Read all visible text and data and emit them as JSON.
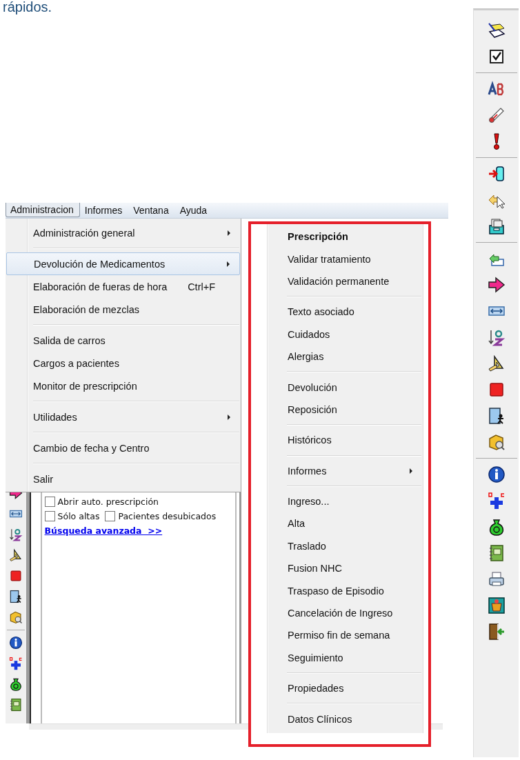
{
  "caption": "rápidos.",
  "menubar": [
    {
      "label": "Administracion",
      "selected": true
    },
    {
      "label": "Informes",
      "selected": false
    },
    {
      "label": "Ventana",
      "selected": false
    },
    {
      "label": "Ayuda",
      "selected": false
    }
  ],
  "admin_menu": {
    "groups": [
      [
        {
          "label": "Administración general",
          "submenu": true,
          "selected": false
        }
      ],
      [
        {
          "label": "Devolución de Medicamentos",
          "submenu": true,
          "selected": true
        },
        {
          "label": "Elaboración de fueras de hora",
          "shortcut": "Ctrl+F",
          "submenu": false,
          "selected": false
        },
        {
          "label": "Elaboración de mezclas",
          "submenu": false,
          "selected": false
        }
      ],
      [
        {
          "label": "Salida de carros",
          "submenu": false,
          "selected": false
        },
        {
          "label": "Cargos a pacientes",
          "submenu": false,
          "selected": false
        },
        {
          "label": "Monitor de prescripción",
          "submenu": false,
          "selected": false
        }
      ],
      [
        {
          "label": "Utilidades",
          "submenu": true,
          "selected": false
        }
      ],
      [
        {
          "label": "Cambio de fecha y Centro",
          "submenu": false,
          "selected": false
        }
      ],
      [
        {
          "label": "Salir",
          "submenu": false,
          "selected": false
        }
      ]
    ]
  },
  "patient_panel": {
    "checkbox_rows": [
      [
        {
          "label": "Abrir auto. prescripción",
          "checked": false
        }
      ],
      [
        {
          "label": "Sólo altas",
          "checked": false
        },
        {
          "label": "Pacientes desubicados",
          "checked": false
        }
      ]
    ],
    "link": "Búsqueda avanzada  >>"
  },
  "context_menu": {
    "groups": [
      [
        {
          "label": "Prescripción",
          "default": true,
          "submenu": false,
          "selected": false
        },
        {
          "label": "Validar tratamiento",
          "default": false,
          "submenu": false,
          "selected": false
        },
        {
          "label": "Validación permanente",
          "default": false,
          "submenu": false,
          "selected": false
        }
      ],
      [
        {
          "label": "Texto asociado",
          "default": false,
          "submenu": false,
          "selected": false
        },
        {
          "label": "Cuidados",
          "default": false,
          "submenu": false,
          "selected": false
        },
        {
          "label": "Alergias",
          "default": false,
          "submenu": false,
          "selected": false
        }
      ],
      [
        {
          "label": "Devolución",
          "default": false,
          "submenu": false,
          "selected": false
        },
        {
          "label": "Reposición",
          "default": false,
          "submenu": false,
          "selected": false
        }
      ],
      [
        {
          "label": "Históricos",
          "default": false,
          "submenu": false,
          "selected": false
        }
      ],
      [
        {
          "label": "Informes",
          "default": false,
          "submenu": true,
          "selected": false
        }
      ],
      [
        {
          "label": "Ingreso...",
          "default": false,
          "submenu": false,
          "selected": false
        },
        {
          "label": "Alta",
          "default": false,
          "submenu": false,
          "selected": false
        },
        {
          "label": "Traslado",
          "default": false,
          "submenu": false,
          "selected": false
        },
        {
          "label": "Fusion NHC",
          "default": false,
          "submenu": false,
          "selected": false
        },
        {
          "label": "Traspaso de Episodio",
          "default": false,
          "submenu": false,
          "selected": false
        },
        {
          "label": "Cancelación de Ingreso",
          "default": false,
          "submenu": false,
          "selected": false
        },
        {
          "label": "Permiso fin de semana",
          "default": false,
          "submenu": false,
          "selected": false
        },
        {
          "label": "Seguimiento",
          "default": false,
          "submenu": false,
          "selected": false
        }
      ],
      [
        {
          "label": "Propiedades",
          "default": false,
          "submenu": false,
          "selected": false
        }
      ],
      [
        {
          "label": "Datos Clínicos",
          "default": false,
          "submenu": false,
          "selected": false
        }
      ]
    ]
  }
}
